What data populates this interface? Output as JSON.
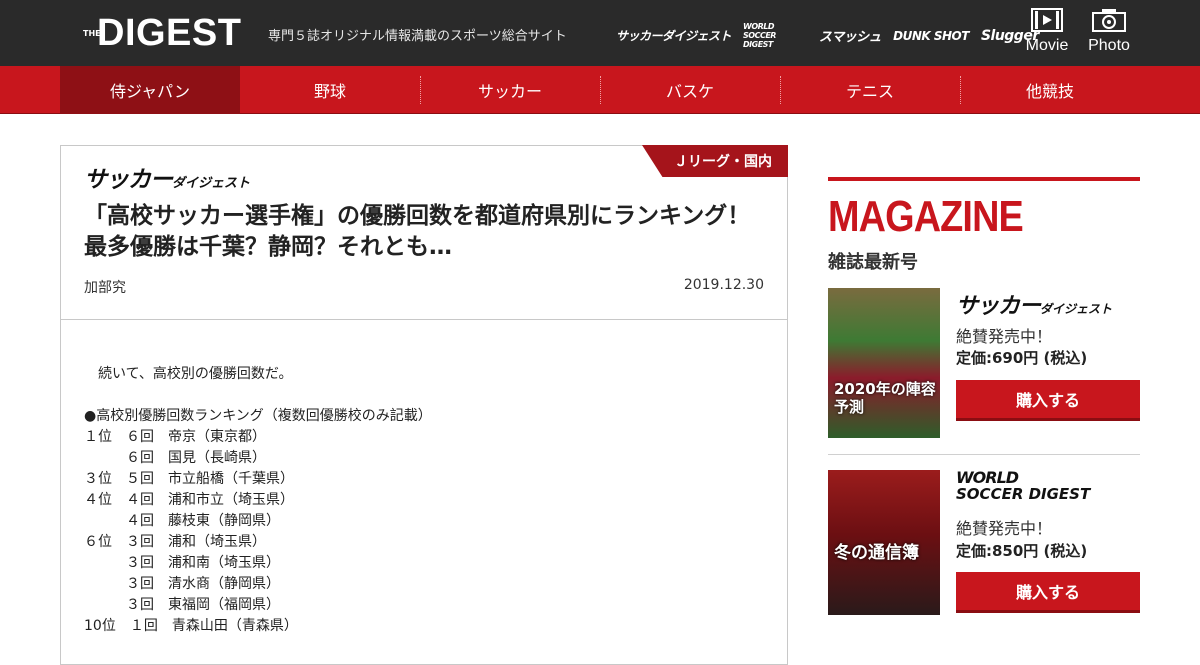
{
  "header": {
    "logo_the": "THE",
    "logo_main": "DIGEST",
    "tagline": "専門５誌オリジナル情報満載のスポーツ総合サイト",
    "brands": [
      "サッカーダイジェスト",
      "WORLD SOCCER DIGEST",
      "スマッシュ",
      "DUNK SHOT",
      "Slugger"
    ],
    "movie_label": "Movie",
    "photo_label": "Photo"
  },
  "nav": {
    "items": [
      {
        "label": "侍ジャパン",
        "active": true
      },
      {
        "label": "野球"
      },
      {
        "label": "サッカー"
      },
      {
        "label": "バスケ"
      },
      {
        "label": "テニス"
      },
      {
        "label": "他競技"
      }
    ]
  },
  "article": {
    "category": "Ｊリーグ・国内",
    "source_logo": "サッカー",
    "source_logo_sub": "ダイジェスト",
    "headline": "「高校サッカー選手権」の優勝回数を都道府県別にランキング！最多優勝は千葉？静岡？それとも…",
    "author": "加部究",
    "date": "2019.12.30",
    "body": "　続いて、高校別の優勝回数だ。\n\n●高校別優勝回数ランキング（複数回優勝校のみ記載）\n１位　６回　帝京（東京都）\n　　　６回　国見（長崎県）\n３位　５回　市立船橋（千葉県）\n４位　４回　浦和市立（埼玉県）\n　　　４回　藤枝東（静岡県）\n６位　３回　浦和（埼玉県）\n　　　３回　浦和南（埼玉県）\n　　　３回　清水商（静岡県）\n　　　３回　東福岡（福岡県）\n10位　１回　青森山田（青森県）"
  },
  "sidebar": {
    "title": "MAGAZINE",
    "subtitle": "雑誌最新号",
    "magazines": [
      {
        "logo": "サッカー",
        "logo_sub": "ダイジェスト",
        "status": "絶賛発売中！",
        "price": "定価:690円 (税込)",
        "buy_label": "購入する",
        "cover_headline": "2020年の陣容予測"
      },
      {
        "logo": "WORLD",
        "logo_sub": "SOCCER DIGEST",
        "status": "絶賛発売中！",
        "price": "定価:850円 (税込)",
        "buy_label": "購入する",
        "cover_headline": "冬の通信簿"
      }
    ]
  },
  "colors": {
    "accent": "#c8161d",
    "header_bg": "#2a2a2a",
    "nav_active": "#8e1015"
  }
}
